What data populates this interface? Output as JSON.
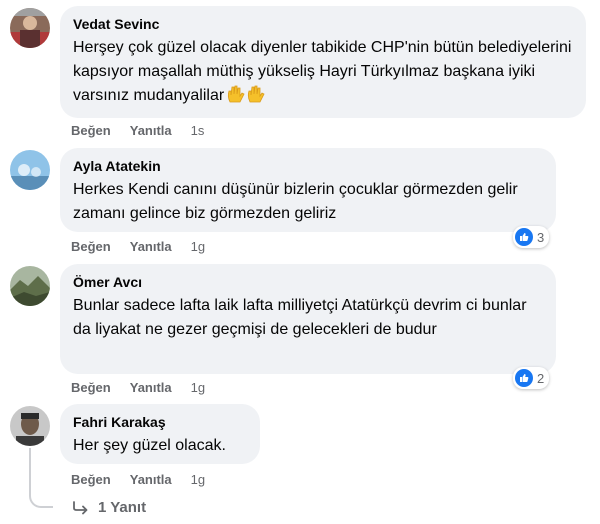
{
  "comments": [
    {
      "author": "Vedat Sevinc",
      "text": "Herşey çok güzel olacak diyenler tabikide CHP'nin bütün belediyelerini kapsıyor maşallah müthiş yükseliş Hayri Türkyılmaz başkana iyiki varsınız mudanyalilar",
      "emoji": "waving-hand-emoji",
      "like_label": "Beğen",
      "reply_label": "Yanıtla",
      "time": "1s"
    },
    {
      "author": "Ayla Atatekin",
      "text": "Herkes Kendi canını düşünür bizlerin çocuklar görmezden gelir zamanı gelince biz görmezden geliriz",
      "like_label": "Beğen",
      "reply_label": "Yanıtla",
      "time": "1g",
      "reaction_count": "3"
    },
    {
      "author": "Ömer Avcı",
      "text": "Bunlar sadece lafta laik lafta milliyetçi Atatürkçü devrim ci bunlar da liyakat ne gezer geçmişi de gelecekleri de budur",
      "like_label": "Beğen",
      "reply_label": "Yanıtla",
      "time": "1g",
      "reaction_count": "2"
    },
    {
      "author": "Fahri Karakaş",
      "text": "Her şey güzel olacak.",
      "like_label": "Beğen",
      "reply_label": "Yanıtla",
      "time": "1g"
    }
  ],
  "replies_link": "1 Yanıt",
  "colors": {
    "bubble": "#f0f2f5",
    "action_text": "#65676b",
    "like_blue": "#1877f2",
    "thread_line": "#ced0d4"
  }
}
